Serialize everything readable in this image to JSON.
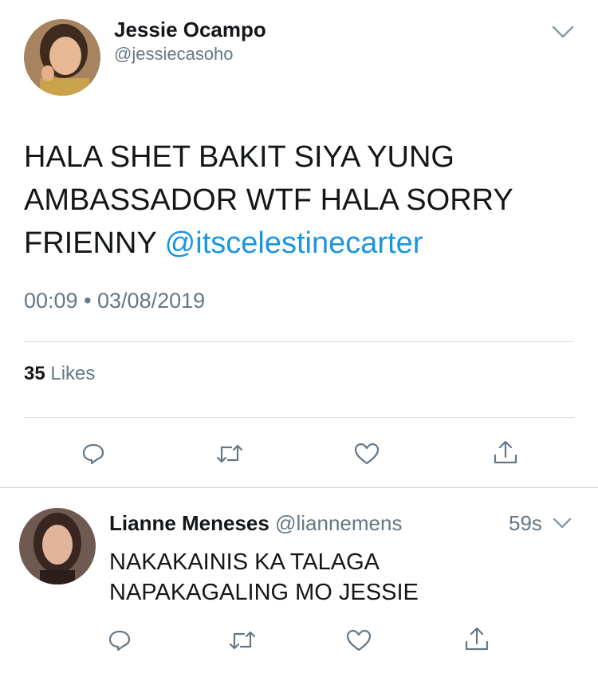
{
  "main_tweet": {
    "author_name": "Jessie Ocampo",
    "author_handle": "@jessiecasoho",
    "text": "HALA SHET BAKIT SIYA YUNG AMBASSADOR WTF HALA SORRY FRIENNY ",
    "mention": "@itscelestinecarter",
    "timestamp": "00:09 • 03/08/2019",
    "likes_count": "35",
    "likes_label": "Likes"
  },
  "reply": {
    "author_name": "Lianne Meneses",
    "author_handle": "@liannemens",
    "time": "59s",
    "text_line1": "NAKAKAINIS KA TALAGA",
    "text_line2": "NAPAKAGALING MO JESSIE"
  },
  "actions": [
    "reply-icon",
    "retweet-icon",
    "like-icon",
    "share-icon"
  ],
  "colors": {
    "accent": "#1b95e0",
    "text": "#14171a",
    "muted": "#657786",
    "divider": "#d7dde2"
  }
}
